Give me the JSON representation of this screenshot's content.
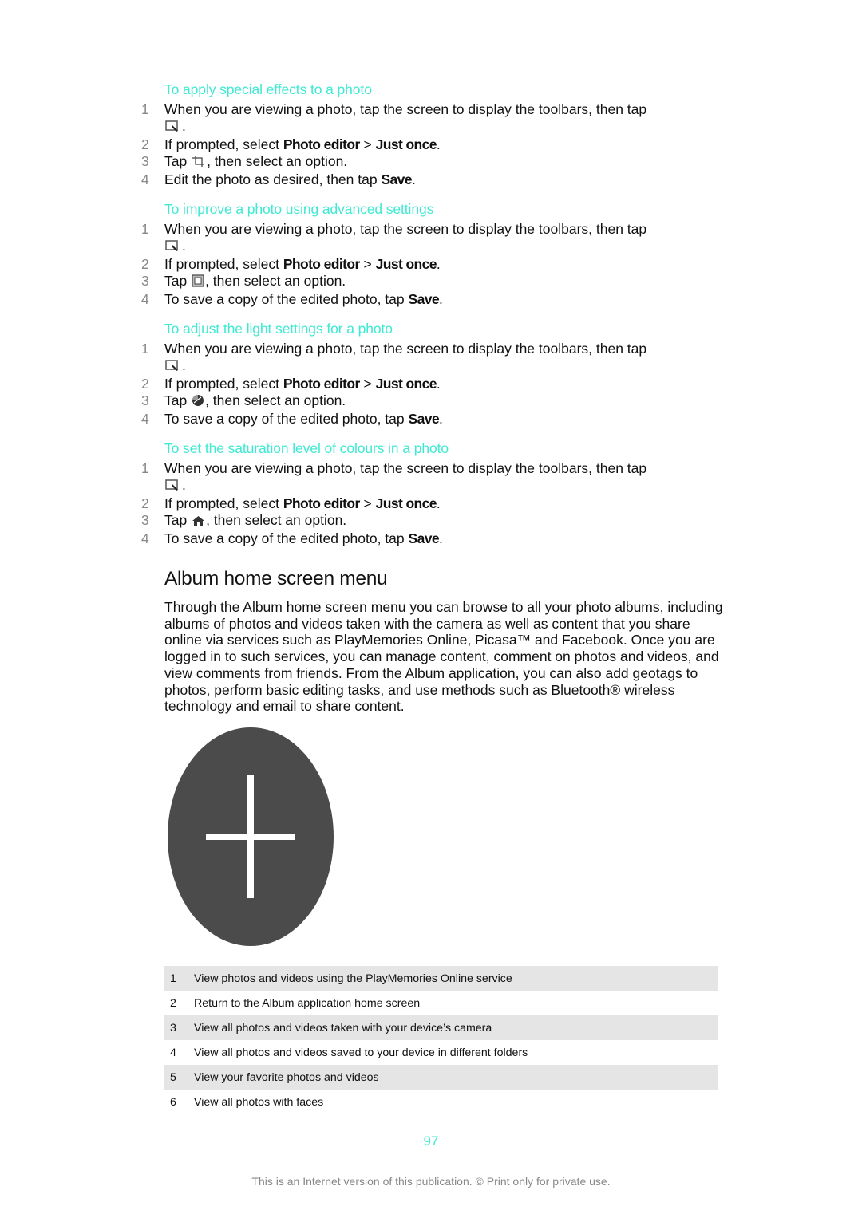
{
  "procedures": [
    {
      "title": "To apply special effects to a photo",
      "steps": [
        {
          "num": "1",
          "pre": "When you are viewing a photo, tap the screen to display the toolbars, then tap",
          "icon": "photo-edit-icon",
          "post": "."
        },
        {
          "num": "2",
          "pre": "If prompted, select ",
          "b1": "Photo editor",
          "mid": " > ",
          "b2": "Just once",
          "post": "."
        },
        {
          "num": "3",
          "pre": "Tap ",
          "icon": "crop-icon",
          "post": ", then select an option."
        },
        {
          "num": "4",
          "pre": "Edit the photo as desired, then tap ",
          "b1": "Save",
          "post": "."
        }
      ]
    },
    {
      "title": "To improve a photo using advanced settings",
      "steps": [
        {
          "num": "1",
          "pre": "When you are viewing a photo, tap the screen to display the toolbars, then tap",
          "icon": "photo-edit-icon",
          "post": "."
        },
        {
          "num": "2",
          "pre": "If prompted, select ",
          "b1": "Photo editor",
          "mid": " > ",
          "b2": "Just once",
          "post": "."
        },
        {
          "num": "3",
          "pre": "Tap ",
          "icon": "frame-icon",
          "post": ", then select an option."
        },
        {
          "num": "4",
          "pre": "To save a copy of the edited photo, tap ",
          "b1": "Save",
          "post": "."
        }
      ]
    },
    {
      "title": "To adjust the light settings for a photo",
      "steps": [
        {
          "num": "1",
          "pre": "When you are viewing a photo, tap the screen to display the toolbars, then tap",
          "icon": "photo-edit-icon",
          "post": "."
        },
        {
          "num": "2",
          "pre": "If prompted, select ",
          "b1": "Photo editor",
          "mid": " > ",
          "b2": "Just once",
          "post": "."
        },
        {
          "num": "3",
          "pre": "Tap ",
          "icon": "light-icon",
          "post": ", then select an option."
        },
        {
          "num": "4",
          "pre": "To save a copy of the edited photo, tap ",
          "b1": "Save",
          "post": "."
        }
      ]
    },
    {
      "title": "To set the saturation level of colours in a photo",
      "steps": [
        {
          "num": "1",
          "pre": "When you are viewing a photo, tap the screen to display the toolbars, then tap",
          "icon": "photo-edit-icon",
          "post": "."
        },
        {
          "num": "2",
          "pre": "If prompted, select ",
          "b1": "Photo editor",
          "mid": " > ",
          "b2": "Just once",
          "post": "."
        },
        {
          "num": "3",
          "pre": "Tap ",
          "icon": "saturation-icon",
          "post": ", then select an option."
        },
        {
          "num": "4",
          "pre": "To save a copy of the edited photo, tap ",
          "b1": "Save",
          "post": "."
        }
      ]
    }
  ],
  "section": {
    "title": "Album home screen menu",
    "intro": "Through the Album home screen menu you can browse to all your photo albums, including albums of photos and videos taken with the camera as well as content that you share online via services such as PlayMemories Online, Picasa™ and Facebook. Once you are logged in to such services, you can manage content, comment on photos and videos, and view comments from friends. From the Album application, you can also add geotags to photos, perform basic editing tasks, and use methods such as Bluetooth® wireless technology and email to share content."
  },
  "figure": {
    "icon": "add-icon"
  },
  "legend": [
    {
      "num": "1",
      "text": "View photos and videos using the PlayMemories Online service"
    },
    {
      "num": "2",
      "text": "Return to the Album application home screen"
    },
    {
      "num": "3",
      "text": "View all photos and videos taken with your device’s camera"
    },
    {
      "num": "4",
      "text": "View all photos and videos saved to your device in different folders"
    },
    {
      "num": "5",
      "text": "View your favorite photos and videos"
    },
    {
      "num": "6",
      "text": "View all photos with faces"
    }
  ],
  "page_number": "97",
  "footer": "This is an Internet version of this publication. © Print only for private use.",
  "colors": {
    "heading": "#3FEAD2",
    "table_shade": "#e5e5e5"
  }
}
